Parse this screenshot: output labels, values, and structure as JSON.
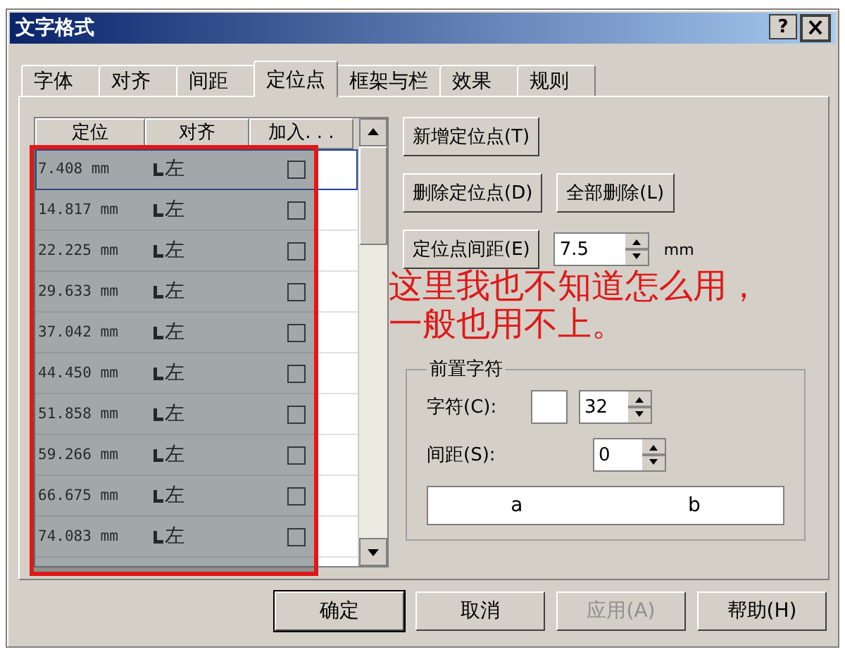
{
  "window": {
    "title": "文字格式",
    "help": "?"
  },
  "tabs": [
    {
      "label": "字体",
      "selected": false
    },
    {
      "label": "对齐",
      "selected": false
    },
    {
      "label": "间距",
      "selected": false
    },
    {
      "label": "定位点",
      "selected": true
    },
    {
      "label": "框架与栏",
      "selected": false
    },
    {
      "label": "效果",
      "selected": false
    },
    {
      "label": "规则",
      "selected": false
    }
  ],
  "table": {
    "columns": [
      "定位",
      "对齐",
      "加入. . ."
    ],
    "rows": [
      {
        "position": "7.408 mm",
        "align": "左",
        "checked": false,
        "selected": true
      },
      {
        "position": "14.817 mm",
        "align": "左",
        "checked": false,
        "selected": false
      },
      {
        "position": "22.225 mm",
        "align": "左",
        "checked": false,
        "selected": false
      },
      {
        "position": "29.633 mm",
        "align": "左",
        "checked": false,
        "selected": false
      },
      {
        "position": "37.042 mm",
        "align": "左",
        "checked": false,
        "selected": false
      },
      {
        "position": "44.450 mm",
        "align": "左",
        "checked": false,
        "selected": false
      },
      {
        "position": "51.858 mm",
        "align": "左",
        "checked": false,
        "selected": false
      },
      {
        "position": "59.266 mm",
        "align": "左",
        "checked": false,
        "selected": false
      },
      {
        "position": "66.675 mm",
        "align": "左",
        "checked": false,
        "selected": false
      },
      {
        "position": "74.083 mm",
        "align": "左",
        "checked": false,
        "selected": false
      }
    ]
  },
  "actions": {
    "add": "新增定位点(T)",
    "delete": "删除定位点(D)",
    "delete_all": "全部删除(L)"
  },
  "spacing": {
    "button": "定位点间距(E)",
    "value": "7.5",
    "unit": "mm"
  },
  "leader": {
    "title": "前置字符",
    "char_label": "字符(C):",
    "char_value": "32",
    "spacing_label": "间距(S):",
    "spacing_value": "0",
    "preview": [
      "a",
      "b"
    ]
  },
  "footer": [
    {
      "label": "确定",
      "default": true,
      "disabled": false
    },
    {
      "label": "取消",
      "default": false,
      "disabled": false
    },
    {
      "label": "应用(A)",
      "default": false,
      "disabled": true
    },
    {
      "label": "帮助(H)",
      "default": false,
      "disabled": false
    }
  ],
  "annotation": [
    "这里我也不知道怎么用，",
    "一般也用不上。"
  ]
}
